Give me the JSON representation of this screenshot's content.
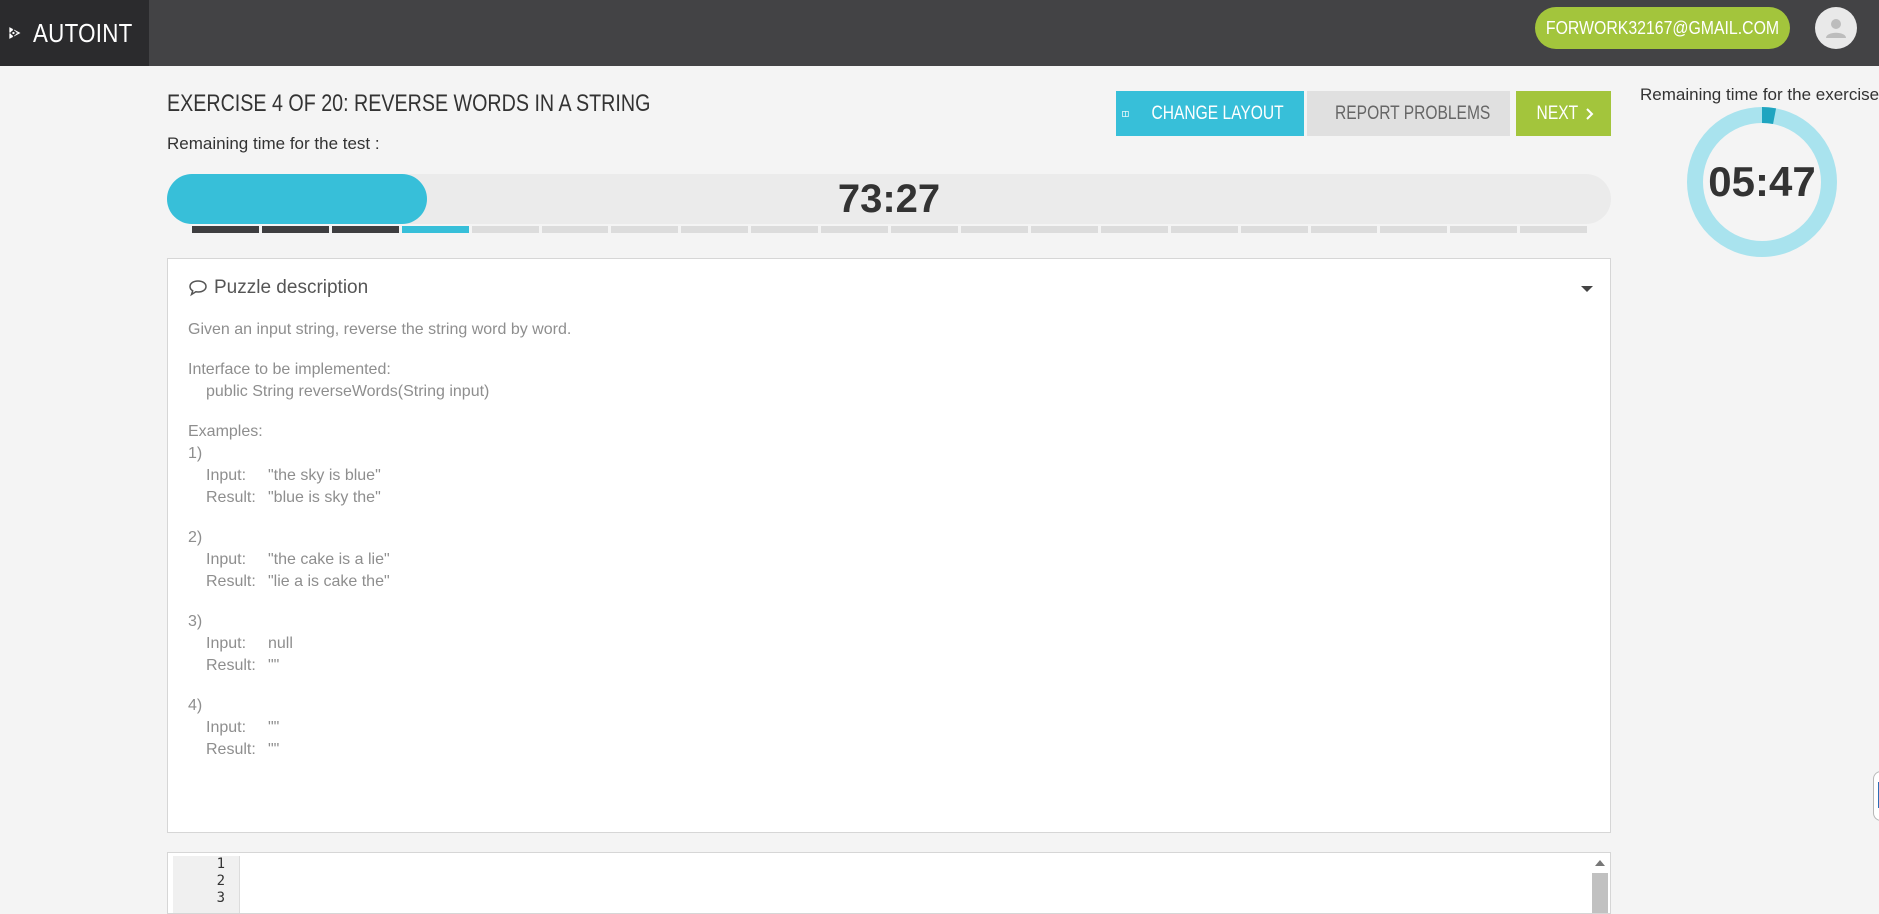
{
  "brand": {
    "name": "AUTOINT",
    "logo_icon": "play-gear-icon"
  },
  "user": {
    "email": "FORWORK32167@GMAIL.COM",
    "avatar_icon": "user-avatar-icon"
  },
  "exercise": {
    "title": "EXERCISE 4 OF 20: REVERSE WORDS IN A STRING",
    "remaining_test_label": "Remaining time for the test :",
    "test_time": "73:27",
    "test_progress": 0.18,
    "segments_total": 20,
    "segments_done": 3,
    "current_segment": 4
  },
  "toolbar": {
    "change_layout": "CHANGE LAYOUT",
    "report_problems": "REPORT PROBLEMS",
    "next": "NEXT"
  },
  "exercise_timer": {
    "label": "Remaining time for the exercise",
    "time": "05:47",
    "elapsed_fraction": 0.03
  },
  "puzzle": {
    "heading": "Puzzle description",
    "intro": "Given an input string, reverse the string word by word.",
    "interface_label": "Interface to be implemented:",
    "signature": "public String reverseWords(String input)",
    "examples_label": "Examples:",
    "examples": [
      {
        "num": "1)",
        "input_label": "Input:",
        "input": "\"the sky is blue\"",
        "result_label": "Result:",
        "result": "\"blue is sky the\""
      },
      {
        "num": "2)",
        "input_label": "Input:",
        "input": "\"the cake is a lie\"",
        "result_label": "Result:",
        "result": "\"lie a is cake the\""
      },
      {
        "num": "3)",
        "input_label": "Input:",
        "input": "null",
        "result_label": "Result:",
        "result": "\"\""
      },
      {
        "num": "4)",
        "input_label": "Input:",
        "input": "\"\"",
        "result_label": "Result:",
        "result": "\"\""
      }
    ]
  },
  "editor": {
    "line_numbers": [
      "1",
      "2",
      "3"
    ]
  },
  "colors": {
    "accent": "#37bfd9",
    "green": "#a3c53c",
    "topbar": "#434345",
    "brand_bg": "#2b2b2d"
  }
}
